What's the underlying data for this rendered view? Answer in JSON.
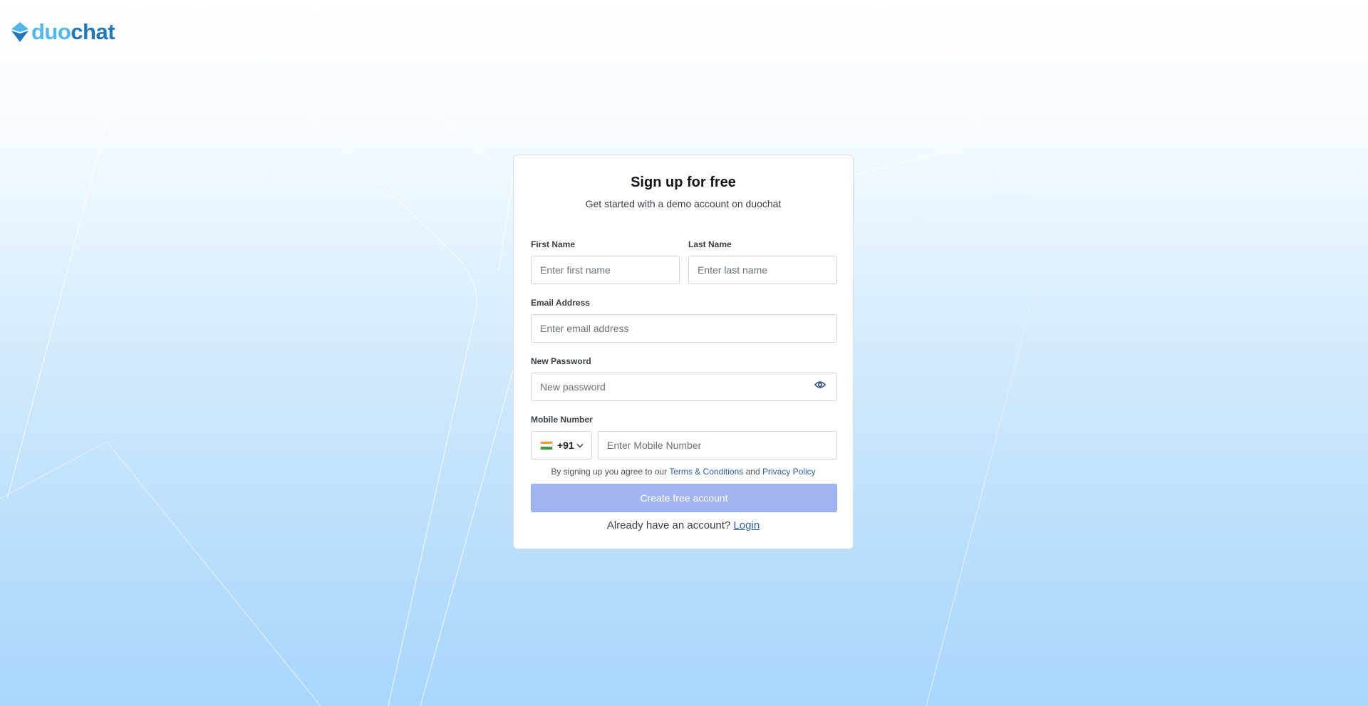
{
  "brand": {
    "name_part1": "duo",
    "name_part2": "chat",
    "logo_icon": "diamond-logo-icon",
    "colors": {
      "light": "#53b7ef",
      "dark": "#2377b8"
    }
  },
  "signup": {
    "title": "Sign up for free",
    "subtitle": "Get started with a demo account on duochat",
    "first_name": {
      "label": "First Name",
      "placeholder": "Enter first name",
      "value": ""
    },
    "last_name": {
      "label": "Last Name",
      "placeholder": "Enter last name",
      "value": ""
    },
    "email": {
      "label": "Email Address",
      "placeholder": "Enter email address",
      "value": ""
    },
    "password": {
      "label": "New Password",
      "placeholder": "New password",
      "value": "",
      "toggle_icon": "eye-icon"
    },
    "mobile": {
      "label": "Mobile Number",
      "country_code": "+91",
      "country_flag": "india-flag-icon",
      "placeholder": "Enter Mobile Number",
      "value": ""
    },
    "terms": {
      "prefix": "By signing up you agree to our",
      "terms_link": "Terms & Conditions",
      "conjunction": "and",
      "privacy_link": "Privacy Policy"
    },
    "submit_label": "Create free account",
    "login_prompt": "Already have an account?",
    "login_link": "Login",
    "colors": {
      "button_bg": "#a0b5f2",
      "link": "#2b5f9e"
    }
  }
}
